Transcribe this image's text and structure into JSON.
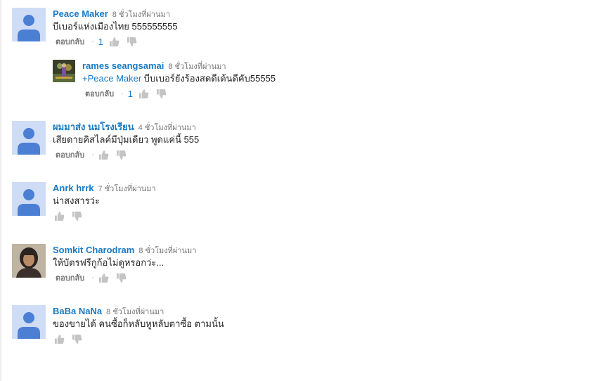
{
  "colors": {
    "author": "#167ac6",
    "meta": "#767676",
    "text": "#222222",
    "avatar_bg": "#cfdcf6",
    "avatar_fg": "#4a7fd4",
    "thumb": "#c4c4c4"
  },
  "comments": [
    {
      "author": "Peace Maker",
      "time": "8 ชั่วโมงที่ผ่านมา",
      "text": "บีเบอร์แห่งเมืองไทย 555555555",
      "reply_label": "ตอบกลับ",
      "separator": "·",
      "likes": "1",
      "avatar": "default-avatar-icon"
    },
    {
      "author": "rames seangsamai",
      "time": "8 ชั่วโมงที่ผ่านมา",
      "mention": "+Peace Maker",
      "text": " บีบเบอร์ยังร้องสดดีเต้นดีคับ55555",
      "reply_label": "ตอบกลับ",
      "separator": "·",
      "likes": "1",
      "avatar": "user-photo-avatar"
    },
    {
      "author": "ผมมาส่ง นมโรงเรียน",
      "time": "4 ชั่วโมงที่ผ่านมา",
      "text": "เสียดายคิสไลค์มีปุ่มเดียว พูดแค่นี้ 555",
      "reply_label": "ตอบกลับ",
      "separator": "·",
      "avatar": "default-avatar-icon"
    },
    {
      "author": "Anrk hrrk",
      "time": "7 ชั่วโมงที่ผ่านมา",
      "text": "น่าสงสารว่ะ",
      "avatar": "default-avatar-icon"
    },
    {
      "author": "Somkit Charodram",
      "time": "8 ชั่วโมงที่ผ่านมา",
      "text": "ให้บัตรฟรีกูก้อไม่ดูหรอกว่ะ...",
      "reply_label": "ตอบกลับ",
      "separator": "·",
      "avatar": "user-photo-avatar"
    },
    {
      "author": "BaBa NaNa",
      "time": "8 ชั่วโมงที่ผ่านมา",
      "text": "ของขายได้ คนซื้อก็หลับหูหลับตาซื้อ ตามนั้น",
      "avatar": "default-avatar-icon"
    }
  ]
}
